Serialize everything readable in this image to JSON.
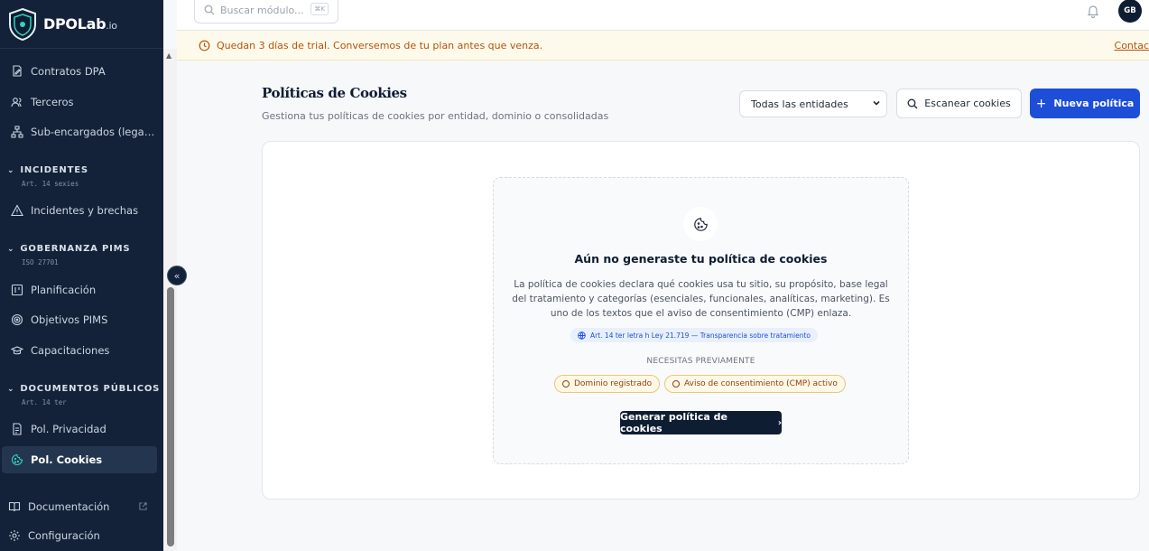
{
  "brand": {
    "name": "DPOLab",
    "suffix": ".io"
  },
  "sidebar": {
    "items_top": [
      {
        "label": "Contratos DPA",
        "icon": "file-signature-icon"
      },
      {
        "label": "Terceros",
        "icon": "users-icon"
      },
      {
        "label": "Sub-encargados (legado)",
        "icon": "sitemap-icon"
      }
    ],
    "sections": [
      {
        "title": "INCIDENTES",
        "subtitle": "Art. 14 sexies",
        "items": [
          {
            "label": "Incidentes y brechas",
            "icon": "alert-triangle-icon"
          }
        ]
      },
      {
        "title": "GOBERNANZA PIMS",
        "subtitle": "ISO 27701",
        "items": [
          {
            "label": "Planificación",
            "icon": "kanban-icon"
          },
          {
            "label": "Objetivos PIMS",
            "icon": "target-icon"
          },
          {
            "label": "Capacitaciones",
            "icon": "graduation-cap-icon"
          }
        ]
      },
      {
        "title": "DOCUMENTOS PÚBLICOS",
        "subtitle": "Art. 14 ter",
        "items": [
          {
            "label": "Pol. Privacidad",
            "icon": "file-text-icon"
          },
          {
            "label": "Pol. Cookies",
            "icon": "cookie-icon",
            "active": true
          }
        ]
      }
    ],
    "footer": [
      {
        "label": "Documentación",
        "icon": "book-icon"
      },
      {
        "label": "Configuración",
        "icon": "gear-icon"
      }
    ]
  },
  "topbar": {
    "search_placeholder": "Buscar módulo...",
    "shortcut": "⌘K",
    "avatar_initials": "GB"
  },
  "banner": {
    "text": "Quedan 3 días de trial. Conversemos de tu plan antes que venza.",
    "link": "Contac"
  },
  "page": {
    "title": "Políticas de Cookies",
    "subtitle": "Gestiona tus políticas de cookies por entidad, dominio o consolidadas",
    "entity_filter": "Todas las entidades",
    "scan_button": "Escanear cookies",
    "new_button": "Nueva política"
  },
  "empty_state": {
    "title": "Aún no generaste tu política de cookies",
    "description": "La política de cookies declara qué cookies usa tu sitio, su propósito, base legal del tratamiento y categorías (esenciales, funcionales, analíticas, marketing). Es uno de los textos que el aviso de consentimiento (CMP) enlaza.",
    "law_ref": "Art. 14 ter letra h Ley 21.719 — Transparencia sobre tratamiento",
    "prereq_label": "NECESITAS PREVIAMENTE",
    "prereqs": [
      "Dominio registrado",
      "Aviso de consentimiento (CMP) activo"
    ],
    "cta": "Generar política de cookies"
  }
}
